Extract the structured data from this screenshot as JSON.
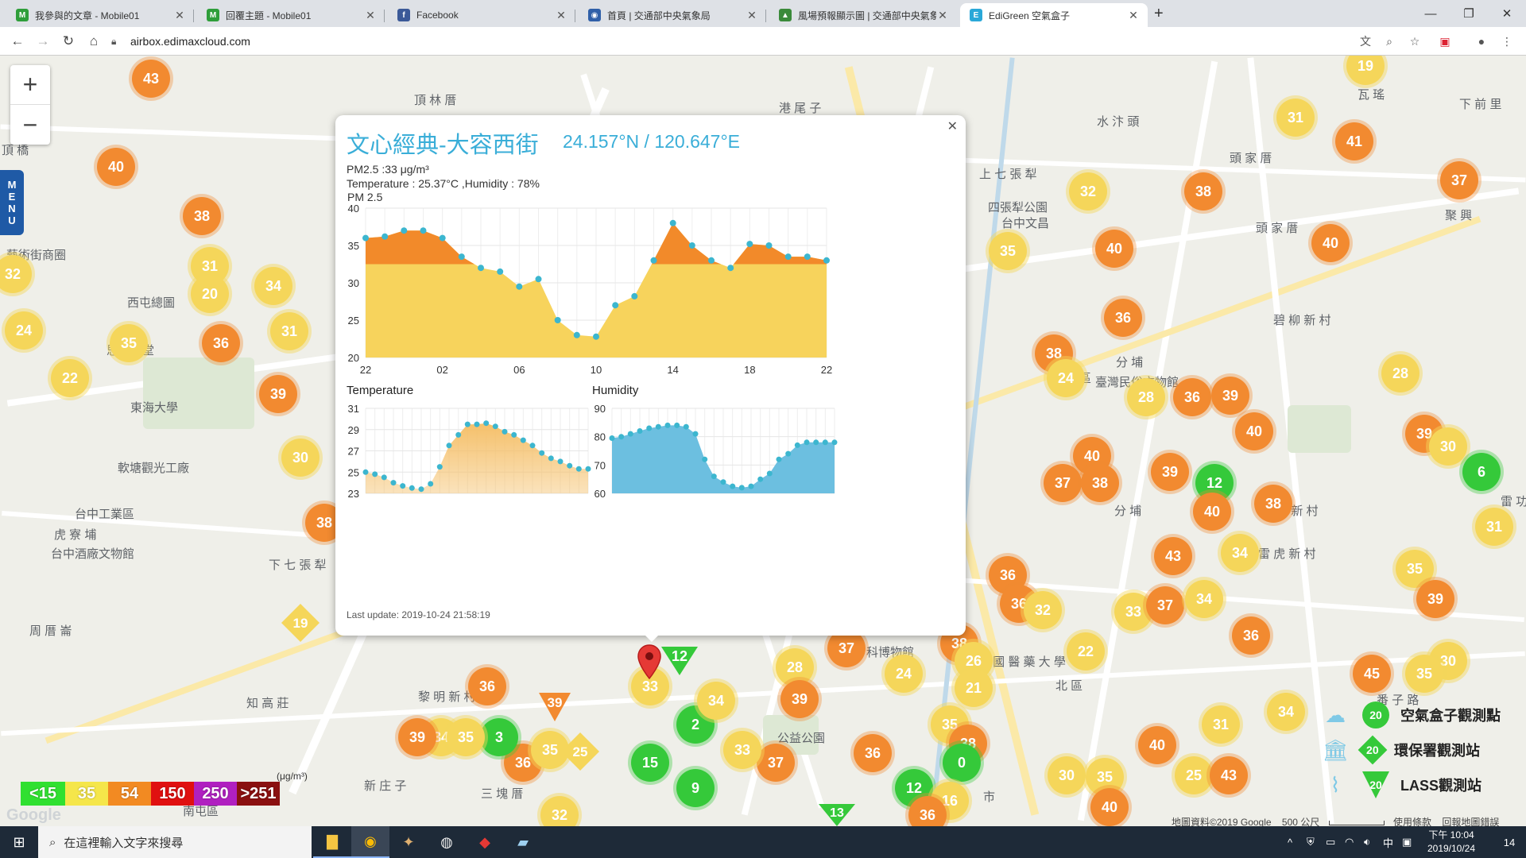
{
  "browser": {
    "tabs": [
      {
        "title": "我參與的文章 - Mobile01",
        "fav_color": "#2e9e3a",
        "fav_glyph": "M"
      },
      {
        "title": "回覆主題 - Mobile01",
        "fav_color": "#2e9e3a",
        "fav_glyph": "M"
      },
      {
        "title": "Facebook",
        "fav_color": "#3b5998",
        "fav_glyph": "f"
      },
      {
        "title": "首頁 | 交通部中央氣象局",
        "fav_color": "#2f5fa8",
        "fav_glyph": "◉"
      },
      {
        "title": "風場預報顯示圖 | 交通部中央氣象",
        "fav_color": "#3a8a3a",
        "fav_glyph": "▲"
      },
      {
        "title": "EdiGreen 空氣盒子",
        "fav_color": "#2aa8d8",
        "fav_glyph": "E"
      }
    ],
    "url": "airbox.edimaxcloud.com"
  },
  "map": {
    "place_names": [
      {
        "text": "頂 林 厝",
        "x": 521,
        "y": 45
      },
      {
        "text": "港 尾 子",
        "x": 980,
        "y": 55
      },
      {
        "text": "水 汴 頭",
        "x": 1380,
        "y": 72
      },
      {
        "text": "瓦 瑤",
        "x": 1708,
        "y": 38
      },
      {
        "text": "下 前 里",
        "x": 1836,
        "y": 50
      },
      {
        "text": "頂 橋",
        "x": 2,
        "y": 108
      },
      {
        "text": "上 七 張 犁",
        "x": 1232,
        "y": 138
      },
      {
        "text": "頭 家 厝",
        "x": 1547,
        "y": 118
      },
      {
        "text": "頭 家 厝",
        "x": 1580,
        "y": 206
      },
      {
        "text": "聚 興",
        "x": 1818,
        "y": 190
      },
      {
        "text": "四張犁公園",
        "x": 1243,
        "y": 180
      },
      {
        "text": "台中文昌",
        "x": 1260,
        "y": 200
      },
      {
        "text": "藝術街商圈",
        "x": 8,
        "y": 240
      },
      {
        "text": "西屯總圖",
        "x": 160,
        "y": 300
      },
      {
        "text": "思義教堂",
        "x": 134,
        "y": 360
      },
      {
        "text": "東海大學",
        "x": 164,
        "y": 432
      },
      {
        "text": "軟塘觀光工廠",
        "x": 148,
        "y": 508
      },
      {
        "text": "台中工業區",
        "x": 94,
        "y": 566
      },
      {
        "text": "虎 寮 埔",
        "x": 68,
        "y": 592
      },
      {
        "text": "台中酒廠文物館",
        "x": 64,
        "y": 616
      },
      {
        "text": "下 七 張 犁",
        "x": 338,
        "y": 630
      },
      {
        "text": "周 厝 崙",
        "x": 37,
        "y": 713
      },
      {
        "text": "知 高 莊",
        "x": 310,
        "y": 804
      },
      {
        "text": "黎 明 新 村",
        "x": 526,
        "y": 796
      },
      {
        "text": "三 塊 厝",
        "x": 605,
        "y": 918
      },
      {
        "text": "新 庄 子",
        "x": 458,
        "y": 908
      },
      {
        "text": "南屯區",
        "x": 230,
        "y": 940
      },
      {
        "text": "北屯區",
        "x": 1328,
        "y": 395
      },
      {
        "text": "分 埔",
        "x": 1404,
        "y": 375
      },
      {
        "text": "臺灣民俗文物館",
        "x": 1378,
        "y": 400
      },
      {
        "text": "碧 柳 新 村",
        "x": 1602,
        "y": 322
      },
      {
        "text": "玫 瑰 新 村",
        "x": 1586,
        "y": 562
      },
      {
        "text": "雷 虎 新 村",
        "x": 1583,
        "y": 616
      },
      {
        "text": "分 埔",
        "x": 1402,
        "y": 562
      },
      {
        "text": "北 區",
        "x": 1328,
        "y": 782
      },
      {
        "text": "科博物館",
        "x": 1090,
        "y": 740
      },
      {
        "text": "中 國 醫 藥 大 學",
        "x": 1230,
        "y": 752
      },
      {
        "text": "公益公園",
        "x": 978,
        "y": 848
      },
      {
        "text": "中 市",
        "x": 1204,
        "y": 760
      },
      {
        "text": "市",
        "x": 1237,
        "y": 922
      },
      {
        "text": "番 子 路",
        "x": 1732,
        "y": 800
      },
      {
        "text": "雷 功",
        "x": 1888,
        "y": 550
      }
    ],
    "markers": [
      {
        "v": "43",
        "c": "orange",
        "x": 190,
        "y": 29
      },
      {
        "v": "40",
        "c": "orange",
        "x": 146,
        "y": 140
      },
      {
        "v": "38",
        "c": "orange",
        "x": 254,
        "y": 202
      },
      {
        "v": "31",
        "c": "yellow",
        "x": 264,
        "y": 265
      },
      {
        "v": "20",
        "c": "yellow",
        "x": 264,
        "y": 300
      },
      {
        "v": "34",
        "c": "yellow",
        "x": 344,
        "y": 290
      },
      {
        "v": "31",
        "c": "yellow",
        "x": 364,
        "y": 347
      },
      {
        "v": "36",
        "c": "orange",
        "x": 278,
        "y": 362
      },
      {
        "v": "32",
        "c": "yellow",
        "x": 16,
        "y": 275
      },
      {
        "v": "24",
        "c": "yellow",
        "x": 30,
        "y": 346
      },
      {
        "v": "35",
        "c": "yellow",
        "x": 162,
        "y": 362
      },
      {
        "v": "22",
        "c": "yellow",
        "x": 88,
        "y": 406
      },
      {
        "v": "39",
        "c": "orange",
        "x": 350,
        "y": 426
      },
      {
        "v": "30",
        "c": "yellow",
        "x": 378,
        "y": 506
      },
      {
        "v": "38",
        "c": "orange",
        "x": 408,
        "y": 588
      },
      {
        "v": "19",
        "c": "yellow",
        "x": 1718,
        "y": 13
      },
      {
        "v": "31",
        "c": "yellow",
        "x": 1630,
        "y": 78
      },
      {
        "v": "41",
        "c": "orange",
        "x": 1704,
        "y": 108
      },
      {
        "v": "37",
        "c": "orange",
        "x": 1836,
        "y": 157
      },
      {
        "v": "38",
        "c": "orange",
        "x": 1514,
        "y": 171
      },
      {
        "v": "32",
        "c": "yellow",
        "x": 1369,
        "y": 171
      },
      {
        "v": "40",
        "c": "orange",
        "x": 1402,
        "y": 243
      },
      {
        "v": "40",
        "c": "orange",
        "x": 1674,
        "y": 236
      },
      {
        "v": "35",
        "c": "yellow",
        "x": 1268,
        "y": 246
      },
      {
        "v": "36",
        "c": "orange",
        "x": 1413,
        "y": 330
      },
      {
        "v": "38",
        "c": "orange",
        "x": 1326,
        "y": 375
      },
      {
        "v": "24",
        "c": "yellow",
        "x": 1341,
        "y": 406
      },
      {
        "v": "28",
        "c": "yellow",
        "x": 1442,
        "y": 430
      },
      {
        "v": "36",
        "c": "orange",
        "x": 1500,
        "y": 430
      },
      {
        "v": "39",
        "c": "orange",
        "x": 1548,
        "y": 428
      },
      {
        "v": "40",
        "c": "orange",
        "x": 1578,
        "y": 473
      },
      {
        "v": "28",
        "c": "yellow",
        "x": 1762,
        "y": 400
      },
      {
        "v": "39",
        "c": "orange",
        "x": 1792,
        "y": 476
      },
      {
        "v": "30",
        "c": "yellow",
        "x": 1822,
        "y": 492
      },
      {
        "v": "6",
        "c": "green",
        "x": 1864,
        "y": 524
      },
      {
        "v": "40",
        "c": "orange",
        "x": 1374,
        "y": 504
      },
      {
        "v": "37",
        "c": "orange",
        "x": 1337,
        "y": 538
      },
      {
        "v": "38",
        "c": "orange",
        "x": 1384,
        "y": 538
      },
      {
        "v": "39",
        "c": "orange",
        "x": 1472,
        "y": 524
      },
      {
        "v": "12",
        "c": "green",
        "x": 1528,
        "y": 538
      },
      {
        "v": "40",
        "c": "orange",
        "x": 1525,
        "y": 574
      },
      {
        "v": "38",
        "c": "orange",
        "x": 1602,
        "y": 564
      },
      {
        "v": "31",
        "c": "yellow",
        "x": 1880,
        "y": 593
      },
      {
        "v": "43",
        "c": "orange",
        "x": 1476,
        "y": 630
      },
      {
        "v": "34",
        "c": "yellow",
        "x": 1560,
        "y": 626
      },
      {
        "v": "36",
        "c": "orange",
        "x": 1268,
        "y": 654
      },
      {
        "v": "36",
        "c": "orange",
        "x": 1282,
        "y": 690
      },
      {
        "v": "32",
        "c": "yellow",
        "x": 1312,
        "y": 698
      },
      {
        "v": "33",
        "c": "yellow",
        "x": 1426,
        "y": 700
      },
      {
        "v": "37",
        "c": "orange",
        "x": 1466,
        "y": 692
      },
      {
        "v": "34",
        "c": "yellow",
        "x": 1515,
        "y": 684
      },
      {
        "v": "35",
        "c": "yellow",
        "x": 1780,
        "y": 646
      },
      {
        "v": "39",
        "c": "orange",
        "x": 1806,
        "y": 684
      },
      {
        "v": "36",
        "c": "orange",
        "x": 1574,
        "y": 730
      },
      {
        "v": "22",
        "c": "yellow",
        "x": 1366,
        "y": 750
      },
      {
        "v": "30",
        "c": "yellow",
        "x": 1822,
        "y": 762
      },
      {
        "v": "35",
        "c": "yellow",
        "x": 1792,
        "y": 778
      },
      {
        "v": "45",
        "c": "orange",
        "x": 1726,
        "y": 778
      },
      {
        "v": "34",
        "c": "yellow",
        "x": 1618,
        "y": 826
      },
      {
        "v": "31",
        "c": "yellow",
        "x": 1536,
        "y": 842
      },
      {
        "v": "40",
        "c": "orange",
        "x": 1456,
        "y": 868
      },
      {
        "v": "25",
        "c": "yellow",
        "x": 1502,
        "y": 906
      },
      {
        "v": "43",
        "c": "orange",
        "x": 1546,
        "y": 906
      },
      {
        "v": "30",
        "c": "yellow",
        "x": 1342,
        "y": 906
      },
      {
        "v": "35",
        "c": "yellow",
        "x": 1390,
        "y": 908
      },
      {
        "v": "40",
        "c": "orange",
        "x": 1396,
        "y": 946
      },
      {
        "v": "37",
        "c": "orange",
        "x": 1065,
        "y": 746
      },
      {
        "v": "38",
        "c": "orange",
        "x": 1207,
        "y": 740
      },
      {
        "v": "26",
        "c": "yellow",
        "x": 1225,
        "y": 762
      },
      {
        "v": "21",
        "c": "yellow",
        "x": 1225,
        "y": 796
      },
      {
        "v": "24",
        "c": "yellow",
        "x": 1137,
        "y": 778
      },
      {
        "v": "28",
        "c": "yellow",
        "x": 1000,
        "y": 770
      },
      {
        "v": "39",
        "c": "orange",
        "x": 1006,
        "y": 810
      },
      {
        "v": "35",
        "c": "yellow",
        "x": 1195,
        "y": 842
      },
      {
        "v": "38",
        "c": "orange",
        "x": 1218,
        "y": 866
      },
      {
        "v": "36",
        "c": "orange",
        "x": 1098,
        "y": 878
      },
      {
        "v": "0",
        "c": "green",
        "x": 1210,
        "y": 890
      },
      {
        "v": "12",
        "c": "green",
        "x": 1150,
        "y": 922
      },
      {
        "v": "16",
        "c": "yellow",
        "x": 1195,
        "y": 938
      },
      {
        "v": "36",
        "c": "orange",
        "x": 1167,
        "y": 956
      },
      {
        "v": "37",
        "c": "orange",
        "x": 976,
        "y": 890
      },
      {
        "v": "33",
        "c": "yellow",
        "x": 934,
        "y": 874
      },
      {
        "v": "15",
        "c": "green",
        "x": 818,
        "y": 890
      },
      {
        "v": "9",
        "c": "green",
        "x": 875,
        "y": 922
      },
      {
        "v": "2",
        "c": "green",
        "x": 875,
        "y": 842
      },
      {
        "v": "34",
        "c": "yellow",
        "x": 901,
        "y": 812
      },
      {
        "v": "33",
        "c": "yellow",
        "x": 818,
        "y": 794
      },
      {
        "v": "36",
        "c": "orange",
        "x": 613,
        "y": 794
      },
      {
        "v": "36",
        "c": "orange",
        "x": 658,
        "y": 890
      },
      {
        "v": "35",
        "c": "yellow",
        "x": 692,
        "y": 874
      },
      {
        "v": "3",
        "c": "green",
        "x": 628,
        "y": 858
      },
      {
        "v": "34",
        "c": "yellow",
        "x": 555,
        "y": 858
      },
      {
        "v": "35",
        "c": "yellow",
        "x": 586,
        "y": 858
      },
      {
        "v": "39",
        "c": "orange",
        "x": 525,
        "y": 858
      },
      {
        "v": "32",
        "c": "yellow",
        "x": 704,
        "y": 956
      }
    ],
    "legend": [
      {
        "label": "<15",
        "color": "#30e030"
      },
      {
        "label": "35",
        "color": "#f5e64a"
      },
      {
        "label": "54",
        "color": "#f28a22"
      },
      {
        "label": "150",
        "color": "#e01010"
      },
      {
        "label": "250",
        "color": "#b020c0"
      },
      {
        "label": ">251",
        "color": "#8a1010"
      }
    ],
    "legend_unit": "(μg/m³)",
    "station_legend": [
      {
        "label": "空氣盒子觀測點",
        "badge_value": "20",
        "icon": "airbox-icon"
      },
      {
        "label": "環保署觀測站",
        "badge_value": "20",
        "icon": "epa-building-icon"
      },
      {
        "label": "LASS觀測站",
        "badge_value": "20",
        "icon": "lass-icon"
      }
    ],
    "footer": {
      "attribution": "地圖資料©2019 Google",
      "scale": "500 公尺",
      "terms": "使用條款",
      "report": "回報地圖錯誤"
    },
    "menu_label": "MENU"
  },
  "popup": {
    "title": "文心經典-大容西街",
    "coordinates": "24.157°N / 120.647°E",
    "pm25_line": "PM2.5 :33 μg/m³",
    "temp_humidity_line": "Temperature : 25.37°C ,Humidity : 78%",
    "pm_chart_title": "PM 2.5",
    "temp_chart_title": "Temperature",
    "humidity_chart_title": "Humidity",
    "last_update": "Last update: 2019-10-24 21:58:19"
  },
  "chart_data": [
    {
      "type": "area",
      "title": "PM 2.5",
      "x_ticks": [
        "22",
        "02",
        "06",
        "10",
        "14",
        "18",
        "22"
      ],
      "ylim": [
        20,
        40
      ],
      "y_ticks": [
        20,
        25,
        30,
        35,
        40
      ],
      "threshold": 32.5,
      "colors": {
        "below": "#f7d35c",
        "above": "#f28a2a",
        "point": "#3cb6cf"
      },
      "values": [
        36,
        36.2,
        37,
        37,
        36,
        33.5,
        32,
        31.5,
        29.5,
        30.5,
        25,
        23,
        22.8,
        27,
        28.2,
        33,
        38,
        35,
        33,
        32,
        35.2,
        35,
        33.5,
        33.5,
        33
      ]
    },
    {
      "type": "area",
      "title": "Temperature",
      "ylim": [
        23,
        31
      ],
      "y_ticks": [
        23,
        25,
        27,
        29,
        31
      ],
      "color": "#f5c06a",
      "values": [
        25,
        24.8,
        24.5,
        24,
        23.7,
        23.5,
        23.4,
        23.9,
        25.5,
        27.5,
        28.5,
        29.5,
        29.5,
        29.6,
        29.3,
        28.8,
        28.5,
        28,
        27.5,
        26.8,
        26.3,
        26,
        25.6,
        25.3,
        25.3
      ]
    },
    {
      "type": "area",
      "title": "Humidity",
      "ylim": [
        60,
        90
      ],
      "y_ticks": [
        60,
        70,
        80,
        90
      ],
      "color": "#6cbfe0",
      "values": [
        79.5,
        80,
        81,
        82,
        83,
        83.5,
        84,
        84,
        83.5,
        81,
        72,
        66,
        64,
        62.5,
        62,
        62.5,
        65,
        67,
        72,
        74,
        77,
        78,
        78,
        78,
        78
      ]
    }
  ],
  "taskbar": {
    "search_placeholder": "在這裡輸入文字來搜尋",
    "time_period": "下午 10:04",
    "date": "2019/10/24",
    "ime": "中",
    "notification_count": "14"
  }
}
